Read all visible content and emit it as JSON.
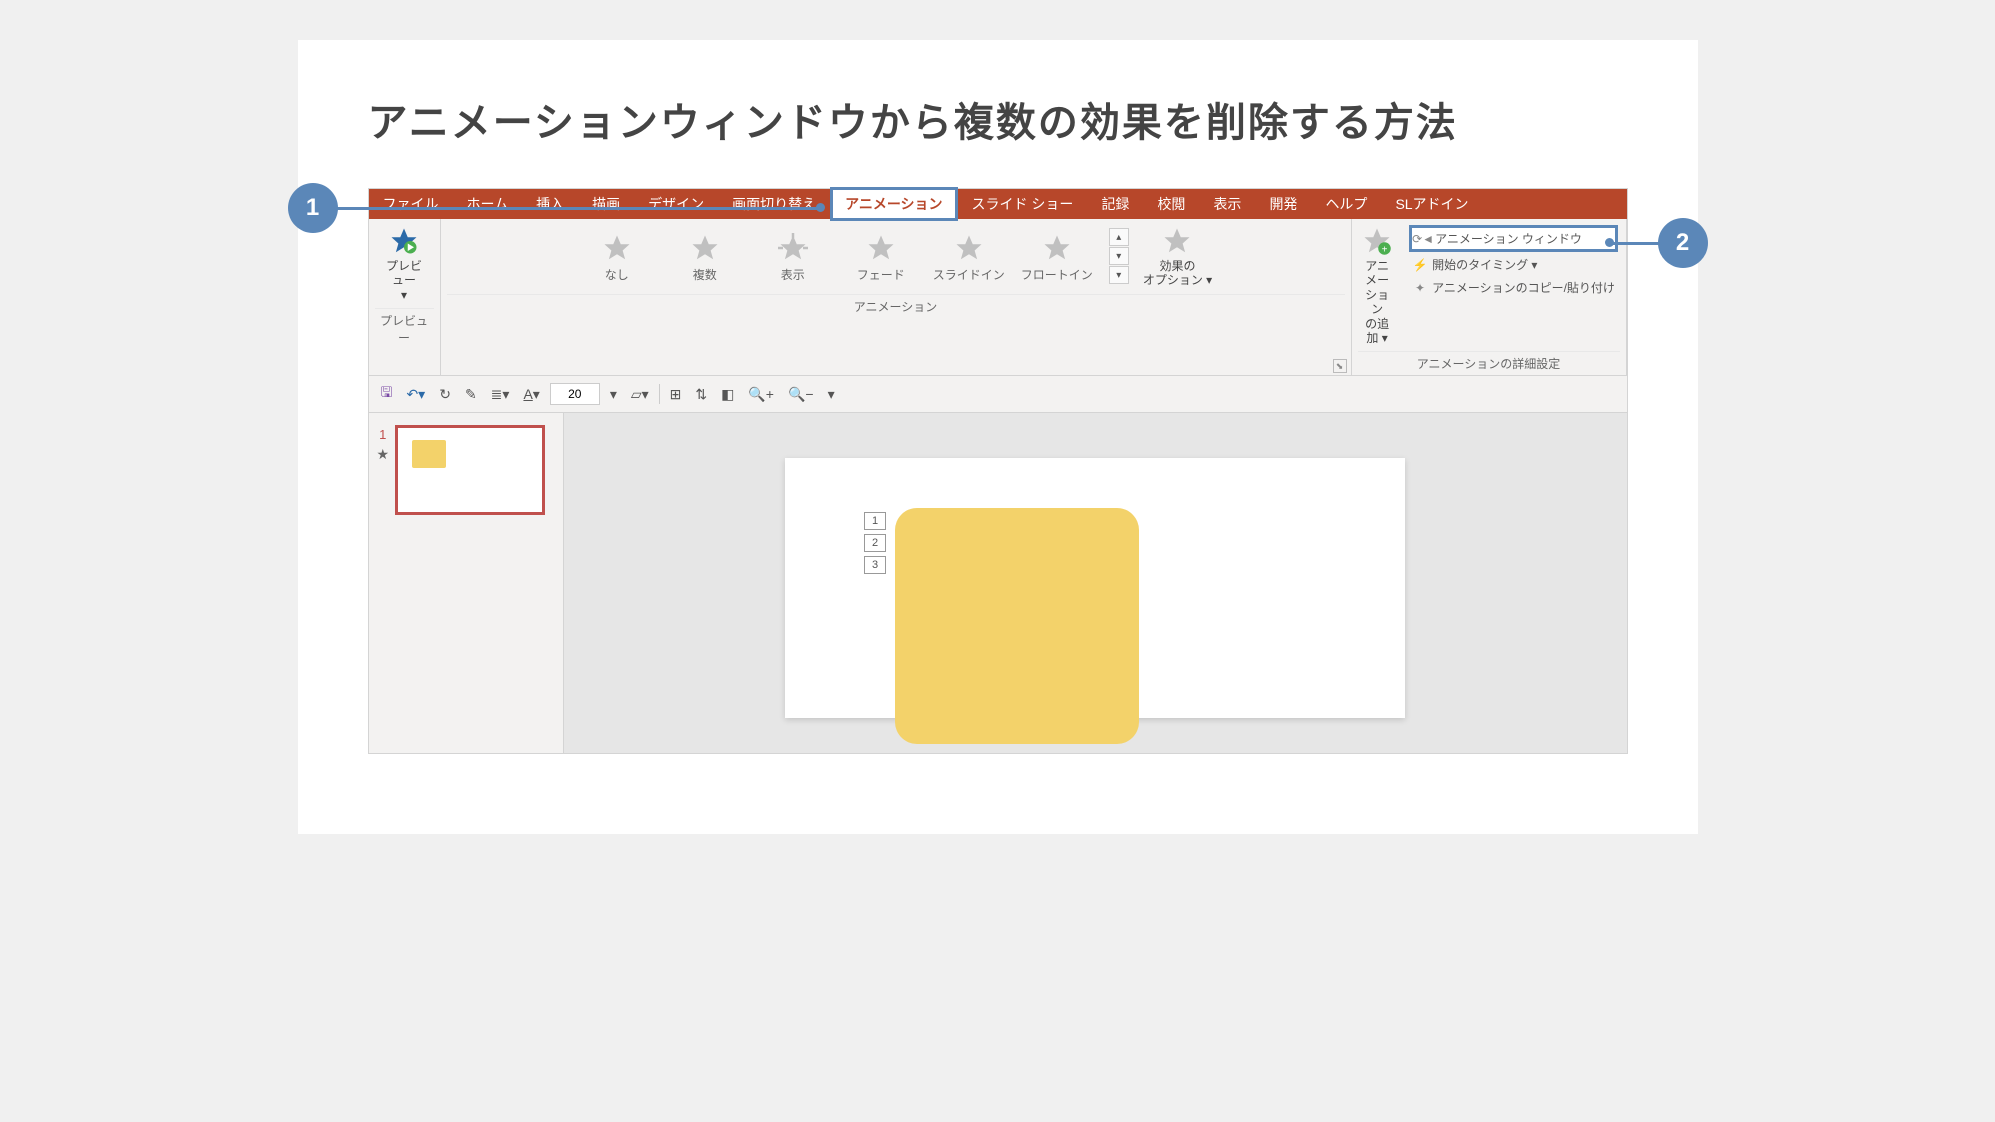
{
  "page": {
    "title": "アニメーションウィンドウから複数の効果を削除する方法"
  },
  "callouts": {
    "one": "1",
    "two": "2"
  },
  "tabs": {
    "file": "ファイル",
    "home": "ホーム",
    "insert": "挿入",
    "draw": "描画",
    "design": "デザイン",
    "transitions": "画面切り替え",
    "animations": "アニメーション",
    "slideshow": "スライド ショー",
    "record": "記録",
    "review": "校閲",
    "view": "表示",
    "developer": "開発",
    "help": "ヘルプ",
    "sladdin": "SLアドイン"
  },
  "ribbon": {
    "preview": {
      "label": "プレビュー",
      "groupLabel": "プレビュー"
    },
    "gallery": {
      "none": "なし",
      "multiple": "複数",
      "appear": "表示",
      "fade": "フェード",
      "flyin": "スライドイン",
      "floatin": "フロートイン",
      "groupLabel": "アニメーション"
    },
    "effectOptions": {
      "label1": "効果の",
      "label2": "オプション ▾"
    },
    "addAnimation": {
      "label1": "アニメーション",
      "label2": "の追加 ▾"
    },
    "advanced": {
      "pane": "アニメーション ウィンドウ",
      "trigger": "開始のタイミング ▾",
      "painter": "アニメーションのコピー/貼り付け",
      "groupLabel": "アニメーションの詳細設定"
    }
  },
  "qat": {
    "fontSize": "20"
  },
  "thumb": {
    "number": "1"
  },
  "animTags": {
    "a1": "1",
    "a2": "2",
    "a3": "3"
  }
}
